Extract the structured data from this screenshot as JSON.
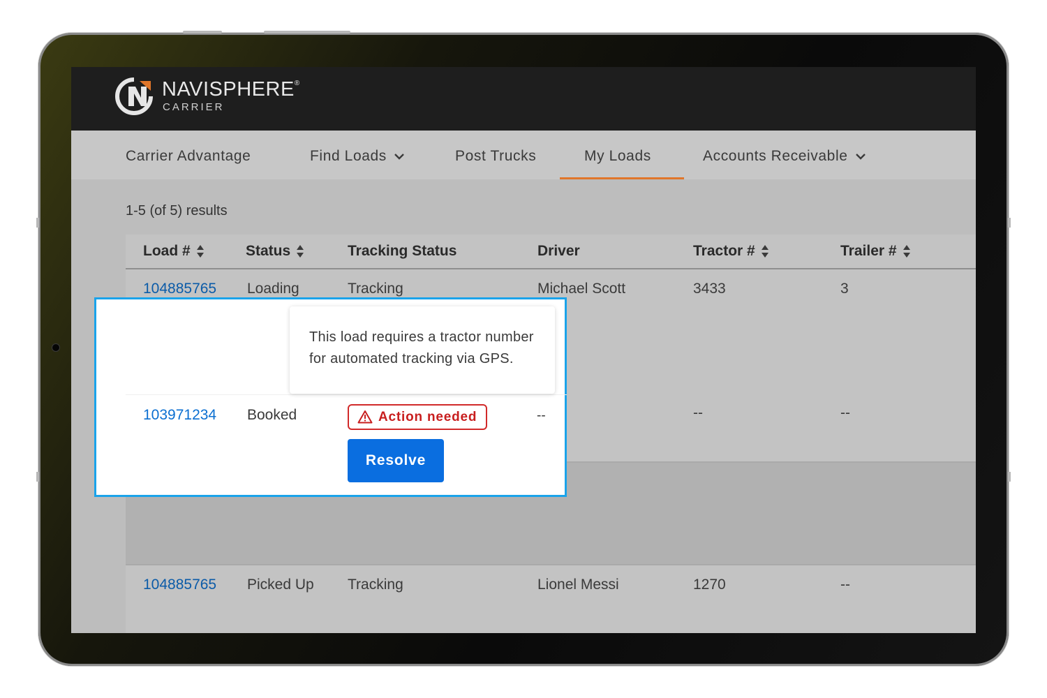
{
  "brand": {
    "name": "NAVISPHERE",
    "registered": "®",
    "sub": "CARRIER"
  },
  "nav": {
    "items": [
      {
        "label": "Carrier Advantage",
        "has_dropdown": false,
        "active": false
      },
      {
        "label": "Find Loads",
        "has_dropdown": true,
        "active": false
      },
      {
        "label": "Post Trucks",
        "has_dropdown": false,
        "active": false
      },
      {
        "label": "My Loads",
        "has_dropdown": false,
        "active": true
      },
      {
        "label": "Accounts Receivable",
        "has_dropdown": true,
        "active": false
      }
    ],
    "accent_color": "#e0762a"
  },
  "results_summary": "1-5 (of 5) results",
  "table": {
    "columns": [
      {
        "label": "Load #",
        "sortable": true
      },
      {
        "label": "Status",
        "sortable": true
      },
      {
        "label": "Tracking Status",
        "sortable": false
      },
      {
        "label": "Driver",
        "sortable": false
      },
      {
        "label": "Tractor #",
        "sortable": true
      },
      {
        "label": "Trailer #",
        "sortable": true
      }
    ],
    "rows": [
      {
        "load": "104885765",
        "status": "Loading",
        "tracking": "Tracking",
        "driver": "Michael Scott",
        "tractor": "3433",
        "trailer": "3"
      },
      {
        "load": "103971234",
        "status": "Booked",
        "tracking": "Action needed",
        "driver": "--",
        "tractor": "--",
        "trailer": "--"
      },
      {
        "load": "104885765",
        "status": "Picked Up",
        "tracking": "Tracking",
        "driver": "Lionel Messi",
        "tractor": "1270",
        "trailer": "--"
      }
    ]
  },
  "callout": {
    "tooltip": "This load requires a tractor number for automated tracking via GPS.",
    "badge_label": "Action needed",
    "badge_icon": "warning-triangle-icon",
    "resolve_label": "Resolve",
    "highlight_color": "#1aa3ea",
    "button_color": "#0a6ee0",
    "badge_color": "#d12a2a"
  }
}
